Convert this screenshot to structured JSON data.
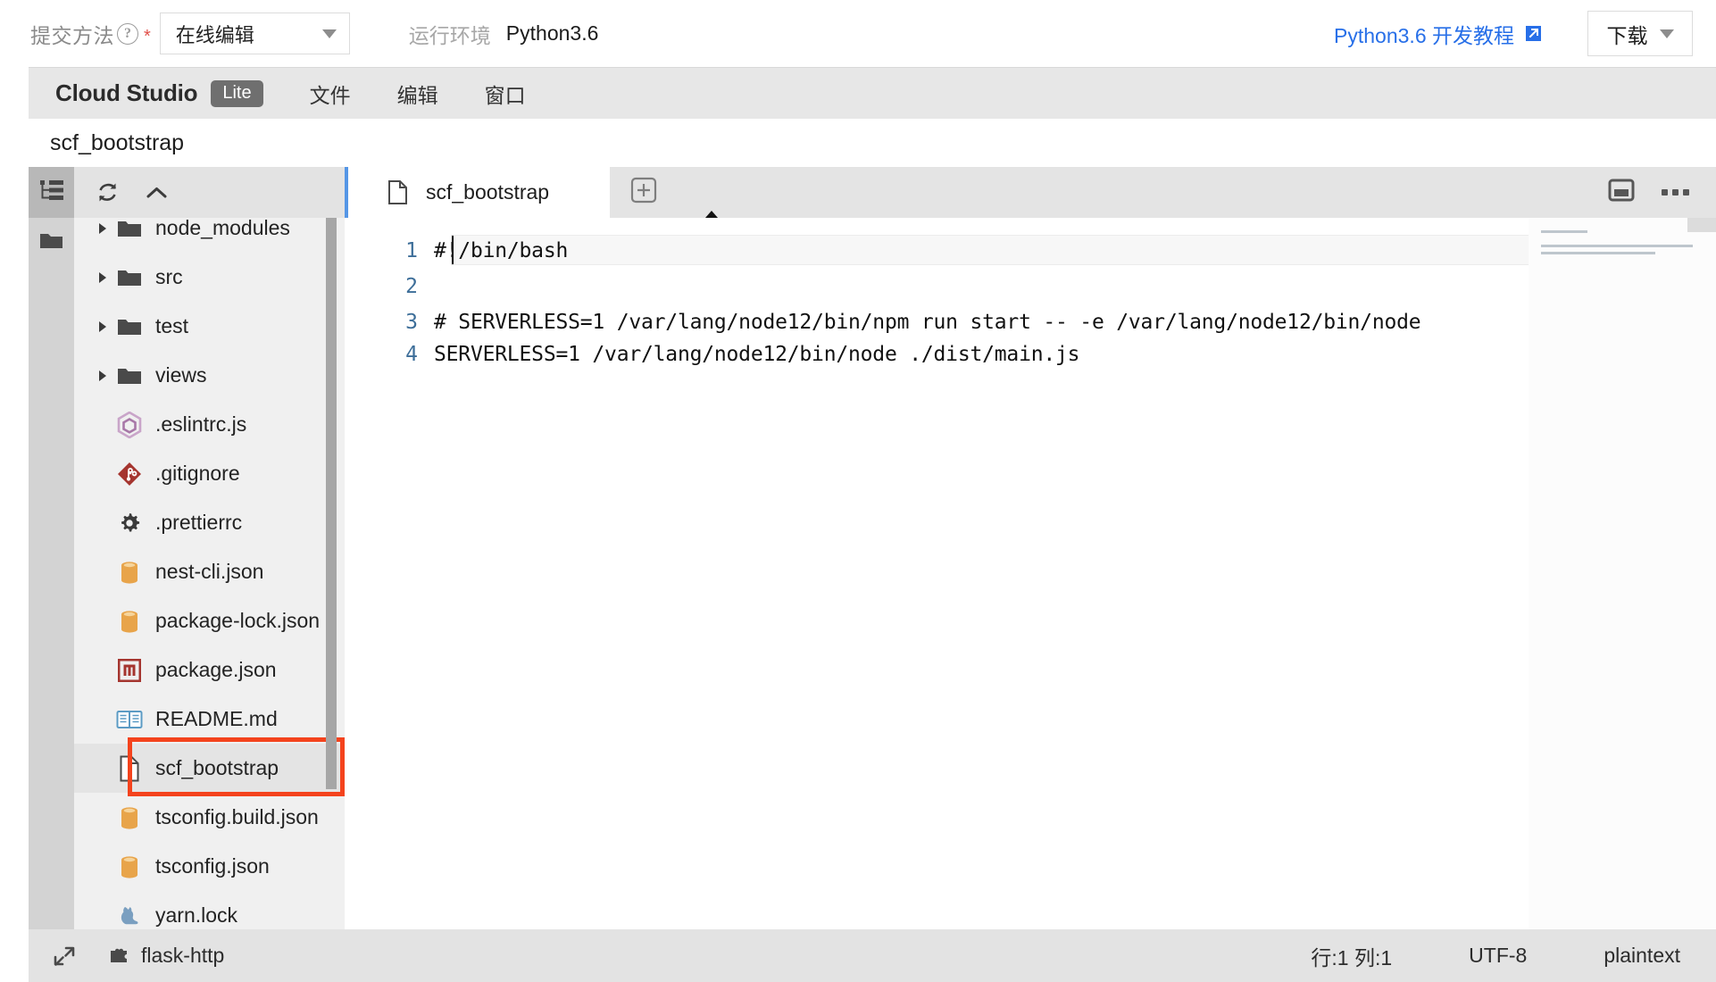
{
  "topbar": {
    "submit_method_label": "提交方法",
    "help_icon": "question-circle-icon",
    "required_mark": "*",
    "method_select_value": "在线编辑",
    "runtime_label": "运行环境",
    "runtime_value": "Python3.6",
    "tutorial_link": "Python3.6 开发教程",
    "external_icon": "external-link-icon",
    "download_label": "下载",
    "accent_link_color": "#276fe8",
    "required_color": "#e1504a"
  },
  "ide": {
    "brand": "Cloud Studio",
    "badge": "Lite",
    "menus": [
      "文件",
      "编辑",
      "窗口"
    ],
    "title": "scf_bootstrap"
  },
  "activitybar": {
    "items": [
      {
        "icon": "file-tree-icon",
        "active": true
      },
      {
        "icon": "folder-open-icon",
        "active": false
      }
    ]
  },
  "explorer": {
    "toolbar": [
      {
        "icon": "refresh-icon"
      },
      {
        "icon": "collapse-all-icon"
      }
    ],
    "highlight_color": "#f4431d",
    "tree": [
      {
        "name": "node_modules",
        "type": "folder",
        "icon": "folder-icon",
        "partial": true
      },
      {
        "name": "src",
        "type": "folder",
        "icon": "folder-icon"
      },
      {
        "name": "test",
        "type": "folder",
        "icon": "folder-icon"
      },
      {
        "name": "views",
        "type": "folder",
        "icon": "folder-icon"
      },
      {
        "name": ".eslintrc.js",
        "type": "file",
        "icon": "eslint-icon"
      },
      {
        "name": ".gitignore",
        "type": "file",
        "icon": "git-icon"
      },
      {
        "name": ".prettierrc",
        "type": "file",
        "icon": "gear-icon"
      },
      {
        "name": "nest-cli.json",
        "type": "file",
        "icon": "json-icon"
      },
      {
        "name": "package-lock.json",
        "type": "file",
        "icon": "json-icon"
      },
      {
        "name": "package.json",
        "type": "file",
        "icon": "npm-icon"
      },
      {
        "name": "README.md",
        "type": "file",
        "icon": "markdown-icon"
      },
      {
        "name": "scf_bootstrap",
        "type": "file",
        "icon": "plain-file-icon",
        "selected": true,
        "highlighted": true
      },
      {
        "name": "tsconfig.build.json",
        "type": "file",
        "icon": "json-icon"
      },
      {
        "name": "tsconfig.json",
        "type": "file",
        "icon": "json-icon"
      },
      {
        "name": "yarn.lock",
        "type": "file",
        "icon": "yarn-icon"
      }
    ]
  },
  "editor": {
    "tab": {
      "label": "scf_bootstrap",
      "icon": "plain-file-icon"
    },
    "new_tab_icon": "plus-square-icon",
    "layout_icon": "split-editor-icon",
    "more_icon": "more-horizontal-icon",
    "lines": [
      {
        "num": "1",
        "text": "#!/bin/bash"
      },
      {
        "num": "2",
        "text": ""
      },
      {
        "num": "3",
        "text": "# SERVERLESS=1 /var/lang/node12/bin/npm run start -- -e /var/lang/node12/bin/node"
      },
      {
        "num": "4",
        "text": "SERVERLESS=1 /var/lang/node12/bin/node ./dist/main.js"
      }
    ]
  },
  "statusbar": {
    "expand_icon": "expand-arrows-icon",
    "plugin_icon": "puzzle-icon",
    "plugin_name": "flask-http",
    "cursor_position": "行:1 列:1",
    "encoding": "UTF-8",
    "language": "plaintext"
  }
}
